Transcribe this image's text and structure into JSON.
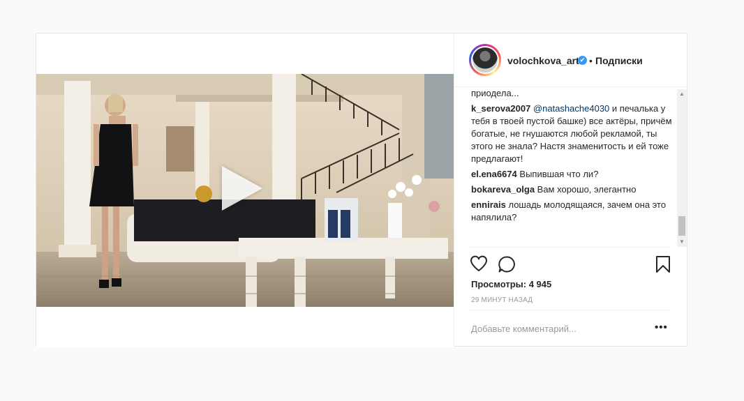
{
  "post": {
    "username": "volochkova_art",
    "verified_badge": "✔",
    "separator": "•",
    "follow_status": "Подписки",
    "video_play_icon": "play-icon"
  },
  "comments": [
    {
      "user": "",
      "text": "приодела..."
    },
    {
      "user": "k_serova2007",
      "mention": "@natashache4030",
      "text": " и печалька у тебя в твоей пустой башке) все актёры, причём богатые, не гнушаются любой рекламой, ты этого не знала? Настя знаменитость и ей тоже предлагают!"
    },
    {
      "user": "el.ena6674",
      "text": " Выпившая что ли?"
    },
    {
      "user": "bokareva_olga",
      "text": " Вам хорошо, элегантно"
    },
    {
      "user": "ennirais",
      "text": " лошадь молодящаяся, зачем она это напялила?"
    }
  ],
  "stats": {
    "views": "Просмотры: 4 945",
    "time": "29 МИНУТ НАЗАД"
  },
  "add_comment": {
    "placeholder": "Добавьте комментарий...",
    "more": "•••"
  },
  "icons": {
    "like": "heart-icon",
    "comment": "comment-icon",
    "save": "bookmark-icon"
  }
}
